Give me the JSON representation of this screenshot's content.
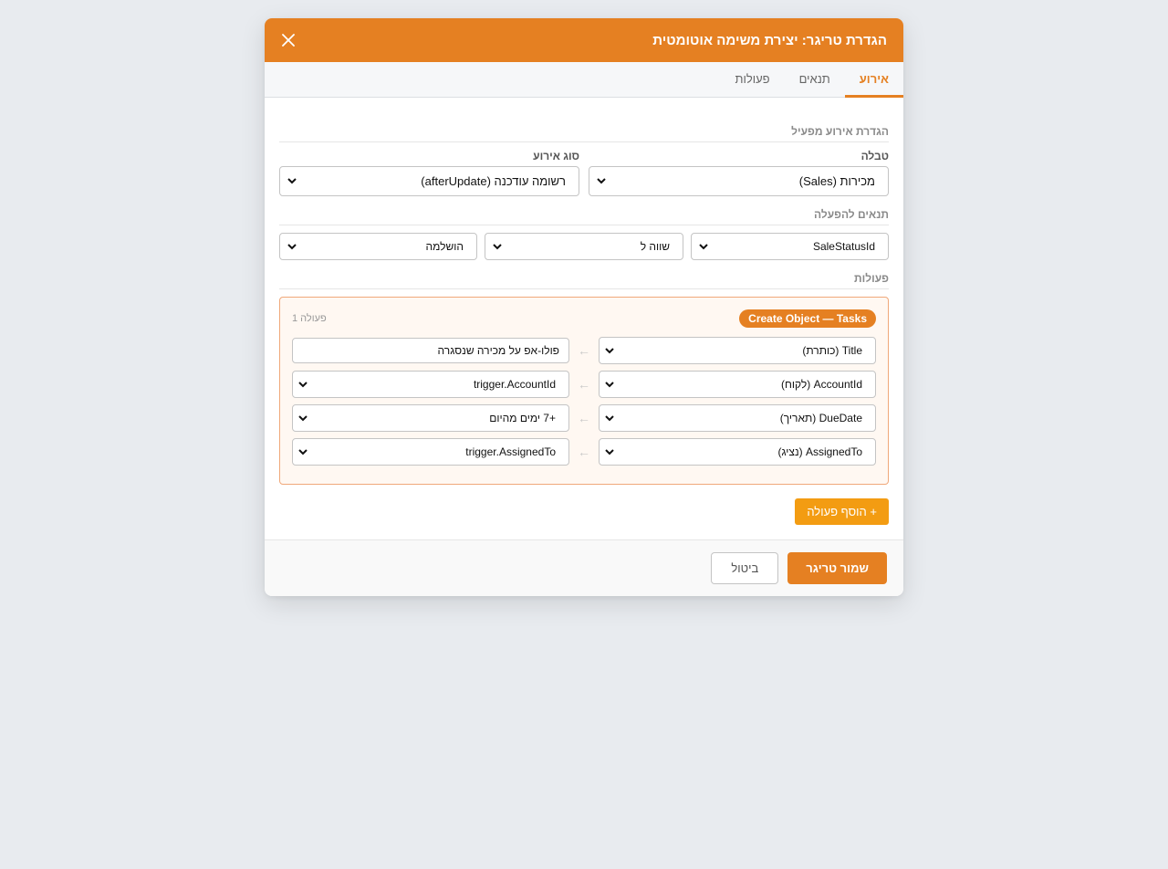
{
  "modal": {
    "title": "הגדרת טריגר: יצירת משימה אוטומטית",
    "close_icon": "close-icon"
  },
  "tabs": [
    {
      "label": "אירוע",
      "active": true
    },
    {
      "label": "תנאים",
      "active": false
    },
    {
      "label": "פעולות",
      "active": false
    }
  ],
  "event_section": {
    "title": "הגדרת אירוע מפעיל",
    "table_label": "טבלה",
    "table_value": "מכירות (Sales)",
    "event_type_label": "סוג אירוע",
    "event_type_value": "רשומה עודכנה (afterUpdate)"
  },
  "conditions_section": {
    "title": "תנאים להפעלה",
    "field": "SaleStatusId",
    "operator": "שווה ל",
    "value": "הושלמה"
  },
  "actions_section": {
    "title": "פעולות",
    "action": {
      "badge": "Create Object — Tasks",
      "number_label": "פעולה 1",
      "mappings": [
        {
          "target": "Title (כותרת)",
          "source": "פולו-אפ על מכירה שנסגרה",
          "source_is_select": false
        },
        {
          "target": "AccountId (לקוח)",
          "source": "trigger.AccountId",
          "source_is_select": true
        },
        {
          "target": "DueDate (תאריך)",
          "source": "+7 ימים מהיום",
          "source_is_select": true
        },
        {
          "target": "AssignedTo (נציג)",
          "source": "trigger.AssignedTo",
          "source_is_select": true
        }
      ]
    },
    "add_button": "+ הוסף פעולה"
  },
  "footer": {
    "save_label": "שמור טריגר",
    "cancel_label": "ביטול"
  },
  "colors": {
    "accent": "#e58022",
    "add_button": "#f39c12",
    "background": "#e8ebef"
  }
}
